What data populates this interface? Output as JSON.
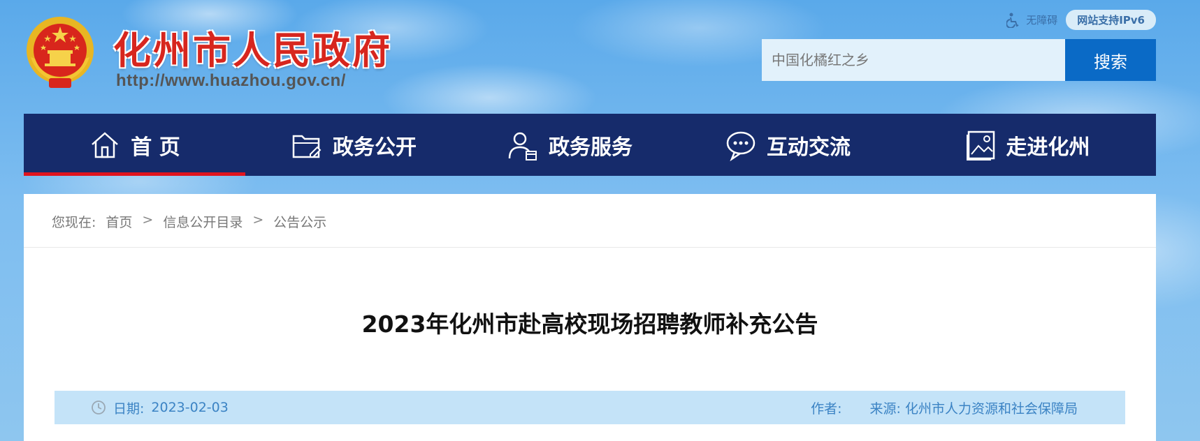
{
  "header": {
    "site_name": "化州市人民政府",
    "site_url": "http://www.huazhou.gov.cn/",
    "accessibility_label": "无障碍",
    "ipv6_label": "网站支持IPv6"
  },
  "search": {
    "placeholder": "中国化橘红之乡",
    "button_label": "搜索"
  },
  "nav": {
    "items": [
      {
        "label": "首 页",
        "icon": "home-icon"
      },
      {
        "label": "政务公开",
        "icon": "folder-edit-icon"
      },
      {
        "label": "政务服务",
        "icon": "user-calendar-icon"
      },
      {
        "label": "互动交流",
        "icon": "chat-bubble-icon"
      },
      {
        "label": "走进化州",
        "icon": "picture-icon"
      }
    ],
    "active_index": 0
  },
  "breadcrumb": {
    "prefix": "您现在:",
    "items": [
      "首页",
      "信息公开目录",
      "公告公示"
    ],
    "separator": ">"
  },
  "article": {
    "title": "2023年化州市赴高校现场招聘教师补充公告",
    "date_label": "日期:",
    "date": "2023-02-03",
    "author_label": "作者:",
    "author": "",
    "source_label": "来源:",
    "source": "化州市人力资源和社会保障局"
  },
  "colors": {
    "nav_bg": "#162b6b",
    "nav_active_underline": "#e0141e",
    "search_button": "#0a6ac6",
    "site_name": "#d7261e",
    "meta_bar_bg": "#c4e3f8",
    "meta_text": "#3b83c4"
  }
}
